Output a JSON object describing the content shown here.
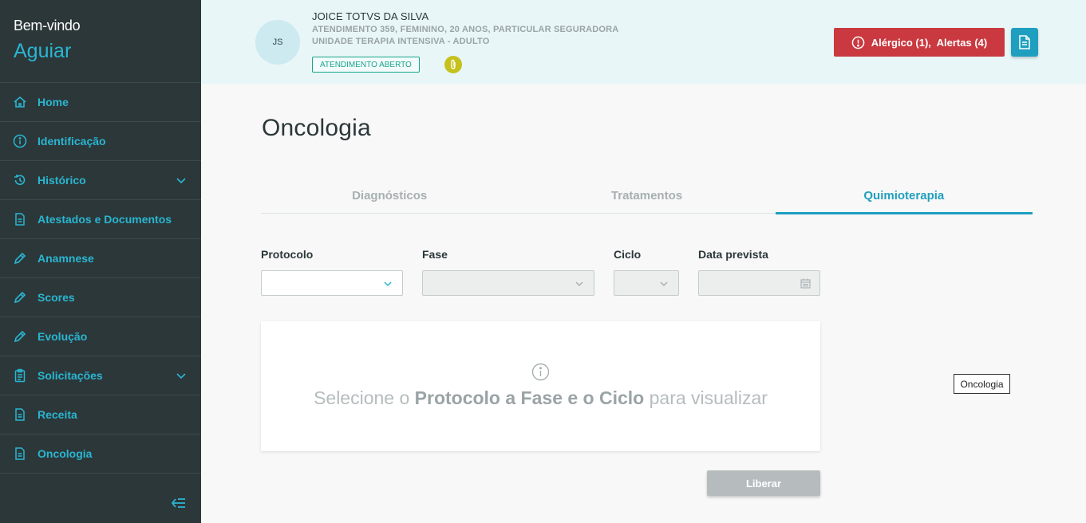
{
  "sidebar": {
    "welcome": "Bem-vindo",
    "user": "Aguiar",
    "items": [
      {
        "label": "Home",
        "icon": "home-icon"
      },
      {
        "label": "Identificação",
        "icon": "info-icon"
      },
      {
        "label": "Histórico",
        "icon": "history-icon",
        "expandable": true
      },
      {
        "label": "Atestados e Documentos",
        "icon": "document-icon"
      },
      {
        "label": "Anamnese",
        "icon": "pencil-icon"
      },
      {
        "label": "Scores",
        "icon": "pencil-icon"
      },
      {
        "label": "Evolução",
        "icon": "pencil-icon"
      },
      {
        "label": "Solicitações",
        "icon": "clipboard-icon",
        "expandable": true
      },
      {
        "label": "Receita",
        "icon": "document-icon"
      },
      {
        "label": "Oncologia",
        "icon": "document-icon"
      }
    ]
  },
  "header": {
    "avatar_initials": "JS",
    "patient_name": "JOICE TOTVS DA SILVA",
    "info_line1": "ATENDIMENTO 359, FEMININO, 20 ANOS, PARTICULAR SEGURADORA",
    "info_line2": "UNIDADE TERAPIA INTENSIVA - ADULTO",
    "status_badge": "ATENDIMENTO ABERTO",
    "alert_label": "Alérgico (1),  Alertas (4)"
  },
  "main": {
    "title": "Oncologia",
    "tabs": [
      "Diagnósticos",
      "Tratamentos",
      "Quimioterapia"
    ],
    "active_tab": "Quimioterapia",
    "fields": {
      "protocolo": "Protocolo",
      "fase": "Fase",
      "ciclo": "Ciclo",
      "data_prevista": "Data prevista"
    },
    "info_pre": "Selecione o ",
    "info_bold": "Protocolo a Fase e o Ciclo",
    "info_post": " para visualizar",
    "liberar": "Liberar",
    "tooltip": "Oncologia"
  },
  "colors": {
    "sidebar_bg": "#2c3739",
    "accent": "#29b6d1",
    "alert": "#c9393f",
    "header_bg": "#e8f6f8"
  }
}
